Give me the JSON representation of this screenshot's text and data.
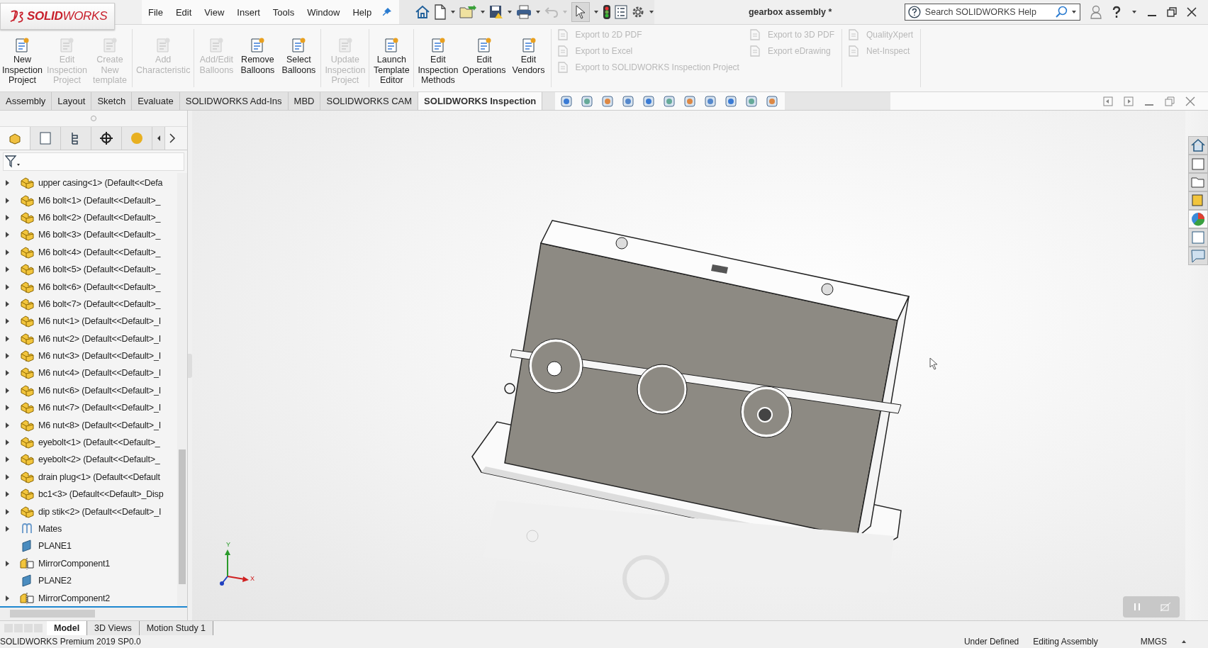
{
  "app": {
    "logo": "**SOLID**WORKS"
  },
  "menu": [
    "File",
    "Edit",
    "View",
    "Insert",
    "Tools",
    "Window",
    "Help"
  ],
  "document_title": "gearbox assembly *",
  "search": {
    "placeholder": "Search SOLIDWORKS Help"
  },
  "ribbon": {
    "groups": [
      [
        {
          "label": "New\nInspection\nProject",
          "disabled": false
        },
        {
          "label": "Edit\nInspection\nProject",
          "disabled": true
        },
        {
          "label": "Create\nNew\ntemplate",
          "disabled": true
        }
      ],
      [
        {
          "label": "Add\nCharacteristic",
          "disabled": true
        }
      ],
      [
        {
          "label": "Add/Edit\nBalloons",
          "disabled": true
        },
        {
          "label": "Remove\nBalloons",
          "disabled": false
        },
        {
          "label": "Select\nBalloons",
          "disabled": false
        }
      ],
      [
        {
          "label": "Update\nInspection\nProject",
          "disabled": true
        }
      ],
      [
        {
          "label": "Launch\nTemplate\nEditor",
          "disabled": false
        }
      ],
      [
        {
          "label": "Edit\nInspection\nMethods",
          "disabled": false
        },
        {
          "label": "Edit\nOperations",
          "disabled": false
        },
        {
          "label": "Edit\nVendors",
          "disabled": false
        }
      ]
    ],
    "small_groups": [
      [
        {
          "label": "Export to 2D PDF",
          "disabled": true
        },
        {
          "label": "Export to Excel",
          "disabled": true
        },
        {
          "label": "Export to SOLIDWORKS Inspection Project",
          "disabled": true
        }
      ],
      [
        {
          "label": "Export to 3D PDF",
          "disabled": true
        },
        {
          "label": "Export eDrawing",
          "disabled": true
        }
      ],
      [
        {
          "label": "QualityXpert",
          "disabled": true
        },
        {
          "label": "Net-Inspect",
          "disabled": true
        }
      ]
    ]
  },
  "command_tabs": [
    {
      "label": "Assembly",
      "selected": false
    },
    {
      "label": "Layout",
      "selected": false
    },
    {
      "label": "Sketch",
      "selected": false
    },
    {
      "label": "Evaluate",
      "selected": false
    },
    {
      "label": "SOLIDWORKS Add-Ins",
      "selected": false
    },
    {
      "label": "MBD",
      "selected": false
    },
    {
      "label": "SOLIDWORKS CAM",
      "selected": false
    },
    {
      "label": "SOLIDWORKS Inspection",
      "selected": true
    }
  ],
  "feature_tree": [
    {
      "label": "upper casing<1> (Default<<Defa",
      "kind": "part",
      "expanded": false
    },
    {
      "label": "M6 bolt<1> (Default<<Default>_",
      "kind": "part",
      "expanded": false
    },
    {
      "label": "M6 bolt<2> (Default<<Default>_",
      "kind": "part",
      "expanded": false
    },
    {
      "label": "M6 bolt<3> (Default<<Default>_",
      "kind": "part",
      "expanded": false
    },
    {
      "label": "M6 bolt<4> (Default<<Default>_",
      "kind": "part",
      "expanded": false
    },
    {
      "label": "M6 bolt<5> (Default<<Default>_",
      "kind": "part",
      "expanded": false
    },
    {
      "label": "M6 bolt<6> (Default<<Default>_",
      "kind": "part",
      "expanded": false
    },
    {
      "label": "M6 bolt<7> (Default<<Default>_",
      "kind": "part",
      "expanded": false
    },
    {
      "label": "M6 nut<1> (Default<<Default>_I",
      "kind": "part",
      "expanded": false
    },
    {
      "label": "M6 nut<2> (Default<<Default>_I",
      "kind": "part",
      "expanded": false
    },
    {
      "label": "M6 nut<3> (Default<<Default>_I",
      "kind": "part",
      "expanded": false
    },
    {
      "label": "M6 nut<4> (Default<<Default>_I",
      "kind": "part",
      "expanded": false
    },
    {
      "label": "M6 nut<6> (Default<<Default>_I",
      "kind": "part",
      "expanded": false
    },
    {
      "label": "M6 nut<7> (Default<<Default>_I",
      "kind": "part",
      "expanded": false
    },
    {
      "label": "M6 nut<8> (Default<<Default>_I",
      "kind": "part",
      "expanded": false
    },
    {
      "label": "eyebolt<1> (Default<<Default>_",
      "kind": "part",
      "expanded": false
    },
    {
      "label": "eyebolt<2> (Default<<Default>_",
      "kind": "part",
      "expanded": false
    },
    {
      "label": "drain plug<1> (Default<<Default",
      "kind": "part",
      "expanded": false
    },
    {
      "label": "bc1<3> (Default<<Default>_Disp",
      "kind": "part",
      "expanded": false
    },
    {
      "label": "dip stik<2> (Default<<Default>_I",
      "kind": "part",
      "expanded": false
    },
    {
      "label": "Mates",
      "kind": "mates",
      "expanded": false
    },
    {
      "label": "PLANE1",
      "kind": "plane"
    },
    {
      "label": "MirrorComponent1",
      "kind": "mirror",
      "expanded": false
    },
    {
      "label": "PLANE2",
      "kind": "plane"
    },
    {
      "label": "MirrorComponent2",
      "kind": "mirror",
      "expanded": false
    }
  ],
  "panel_tabs": [
    {
      "selected": true
    },
    {
      "selected": false
    },
    {
      "selected": false
    },
    {
      "selected": false
    },
    {
      "selected": false
    }
  ],
  "task_pane_tabs": [
    {
      "selected": false
    },
    {
      "selected": false
    },
    {
      "selected": false
    },
    {
      "selected": false
    },
    {
      "selected": true
    },
    {
      "selected": false
    },
    {
      "selected": false
    }
  ],
  "triad": {
    "x": "X",
    "y": "Y"
  },
  "bottom_tabs": [
    {
      "label": "Model",
      "selected": true
    },
    {
      "label": "3D Views",
      "selected": false
    },
    {
      "label": "Motion Study 1",
      "selected": false
    }
  ],
  "status_bar": {
    "version": "SOLIDWORKS Premium 2019 SP0.0",
    "state": "Under Defined",
    "mode": "Editing Assembly",
    "units": "MMGS"
  }
}
